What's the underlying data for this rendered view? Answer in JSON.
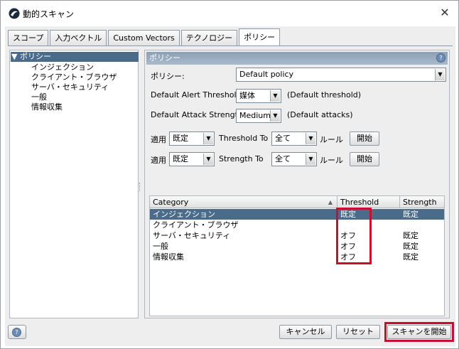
{
  "window": {
    "title": "動的スキャン",
    "close_glyph": "✕"
  },
  "tabs": [
    {
      "label": "スコープ"
    },
    {
      "label": "入力ベクトル"
    },
    {
      "label": "Custom Vectors"
    },
    {
      "label": "テクノロジー"
    },
    {
      "label": "ポリシー"
    }
  ],
  "tree": {
    "root": "▼ ポリシー",
    "children": [
      "インジェクション",
      "クライアント・ブラウザ",
      "サーバ・セキュリティ",
      "一般",
      "情報収集"
    ]
  },
  "panel": {
    "header": "ポリシー",
    "policy_label": "ポリシー:",
    "policy_value": "Default policy",
    "alert_label": "Default Alert Threshold:",
    "alert_value": "媒体",
    "alert_note": "(Default threshold)",
    "attack_label": "Default Attack Strength:",
    "attack_value": "Medium",
    "attack_note": "(Default attacks)",
    "row1": {
      "apply": "適用",
      "sel1": "既定",
      "to_label": "Threshold To",
      "sel2": "全て",
      "rule": "ルール",
      "go": "開始"
    },
    "row2": {
      "apply": "適用",
      "sel1": "既定",
      "to_label": "Strength To",
      "sel2": "全て",
      "rule": "ルール",
      "go": "開始"
    }
  },
  "table": {
    "headers": [
      "Category",
      "Threshold",
      "Strength"
    ],
    "rows": [
      {
        "category": "インジェクション",
        "threshold": "既定",
        "strength": "既定"
      },
      {
        "category": "クライアント・ブラウザ",
        "threshold": "",
        "strength": ""
      },
      {
        "category": "サーバ・セキュリティ",
        "threshold": "オフ",
        "strength": "既定"
      },
      {
        "category": "一般",
        "threshold": "オフ",
        "strength": "既定"
      },
      {
        "category": "情報収集",
        "threshold": "オフ",
        "strength": "既定"
      }
    ]
  },
  "footer": {
    "cancel": "キャンセル",
    "reset": "リセット",
    "start": "スキャンを開始"
  },
  "colors": {
    "highlight": "#c8102e",
    "selection": "#4a6b8a"
  }
}
